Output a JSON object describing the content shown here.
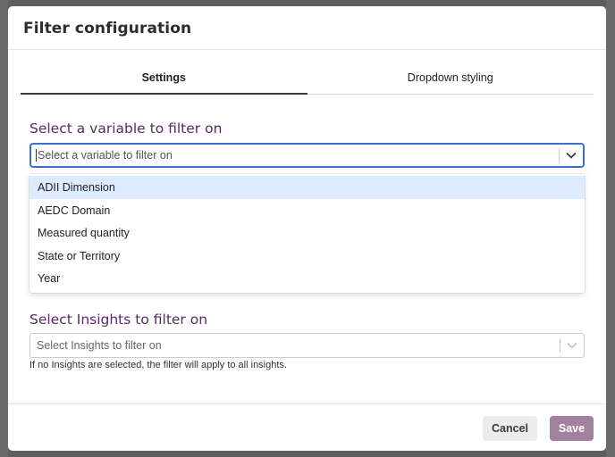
{
  "modal": {
    "title": "Filter configuration"
  },
  "tabs": [
    {
      "label": "Settings",
      "active": true
    },
    {
      "label": "Dropdown styling",
      "active": false
    }
  ],
  "variable_section": {
    "label": "Select a variable to filter on",
    "placeholder": "Select a variable to filter on",
    "options": [
      "ADII Dimension",
      "AEDC Domain",
      "Measured quantity",
      "State or Territory",
      "Year"
    ],
    "highlighted_option": "ADII Dimension"
  },
  "insights_section": {
    "label": "Select Insights to filter on",
    "placeholder": "Select Insights to filter on",
    "helper_text": "If no Insights are selected, the filter will apply to all insights."
  },
  "footer": {
    "cancel_label": "Cancel",
    "save_label": "Save"
  },
  "colors": {
    "accent_heading": "#5a2a63",
    "focus_border": "#3b6fd0",
    "highlight_option": "#deebff",
    "save_button": "#a37fa0"
  }
}
